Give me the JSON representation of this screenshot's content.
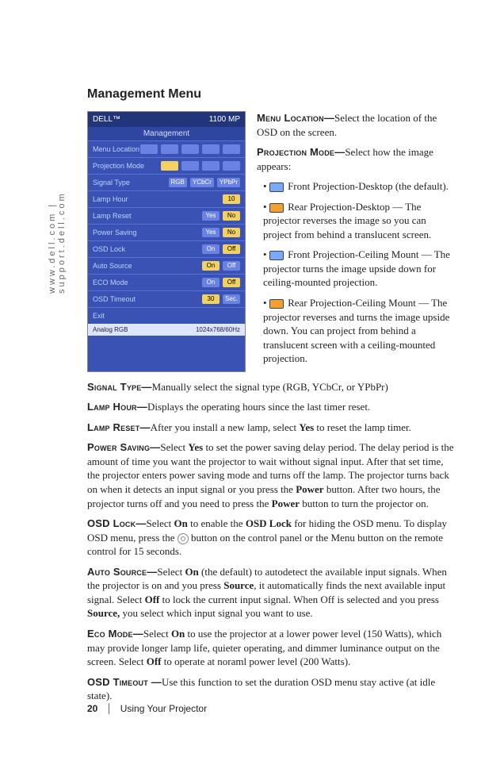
{
  "sidebar": "www.dell.com | support.dell.com",
  "heading": "Management Menu",
  "osd": {
    "brand": "DELL™",
    "model": "1100 MP",
    "title": "Management",
    "rows": [
      {
        "label": "Menu Location",
        "chips": [
          "",
          "",
          "",
          "",
          ""
        ],
        "hi": -1
      },
      {
        "label": "Projection Mode",
        "chips": [
          "",
          "",
          "",
          ""
        ],
        "hi": 0
      },
      {
        "label": "Signal Type",
        "chips": [
          "RGB",
          "YCbCr",
          "YPbPr"
        ],
        "hi": -1
      },
      {
        "label": "Lamp Hour",
        "chips": [
          "10"
        ],
        "hi": 0
      },
      {
        "label": "Lamp Reset",
        "chips": [
          "Yes",
          "No"
        ],
        "hi": 1
      },
      {
        "label": "Power Saving",
        "chips": [
          "Yes",
          "No"
        ],
        "hi": 1
      },
      {
        "label": "OSD Lock",
        "chips": [
          "On",
          "Off"
        ],
        "hi": 1
      },
      {
        "label": "Auto Source",
        "chips": [
          "On",
          "Off"
        ],
        "hi": 0
      },
      {
        "label": "ECO Mode",
        "chips": [
          "On",
          "Off"
        ],
        "hi": 1
      },
      {
        "label": "OSD Timeout",
        "chips": [
          "30",
          "Sec."
        ],
        "hi": 0
      },
      {
        "label": "Exit",
        "chips": [],
        "hi": -1
      }
    ],
    "footer_left": "Analog RGB",
    "footer_right": "1024x768/60Hz"
  },
  "rightcol": {
    "p1a": "Menu Location—",
    "p1b": "Select the location of the OSD on the screen.",
    "p2a": "Projection Mode—",
    "p2b": "Select how the image appears:",
    "b1": " Front Projection-Desktop (the default).",
    "b2": " Rear Projection-Desktop — The projector reverses the image so you can project from behind a translucent screen.",
    "b3": " Front Projection-Ceiling Mount — The projector turns the image upside down for ceiling-mounted projection.",
    "b4": " Rear Projection-Ceiling Mount — The projector reverses and turns the image upside down. You can project from behind a translucent screen with a ceiling-mounted projection."
  },
  "paras": {
    "st_a": "Signal Type—",
    "st_b": "Manually select the signal type (RGB, YCbCr, or YPbPr)",
    "lh_a": "Lamp Hour—",
    "lh_b": "Displays the operating hours since the last timer reset.",
    "lr_a": "Lamp Reset—",
    "lr_b1": "After you install a new lamp, select ",
    "lr_yes": "Yes",
    "lr_b2": " to reset the lamp timer.",
    "ps_a": "Power Saving—",
    "ps_b1": "Select ",
    "ps_yes": "Yes",
    "ps_b2": " to set the power saving delay period. The delay period is the amount of time you want the projector to wait without signal input. After that set time, the projector enters power saving mode and turns off the lamp. The projector turns back on when it detects an input signal or you press the ",
    "ps_pw1": "Power",
    "ps_b3": " button. After two hours, the projector turns off and you need to press the ",
    "ps_pw2": "Power",
    "ps_b4": " button to turn the projector on.",
    "ol_a": "OSD Lock—",
    "ol_b1": "Select ",
    "ol_on": "On",
    "ol_b2": " to enable the ",
    "ol_bold": "OSD Lock",
    "ol_b3": " for hiding the OSD menu. To display OSD menu, press the ",
    "ol_b4": " button on the control panel or the Menu button on the remote control for 15 seconds.",
    "as_a": "Auto Source—",
    "as_b1": "Select ",
    "as_on": "On",
    "as_b2": " (the default) to autodetect the available input signals. When the projector is on and you press ",
    "as_src": "Source",
    "as_b3": ", it automatically finds the next available input signal. Select ",
    "as_off": "Off",
    "as_b4": " to lock the current input signal. When Off is selected and you press ",
    "as_src2": "Source,",
    "as_b5": " you select which input signal you want to use.",
    "em_a": "Eco Mode—",
    "em_b1": "Select ",
    "em_on": "On",
    "em_b2": " to use the projector at a lower power level (150 Watts), which may provide longer lamp life, quieter operating, and dimmer luminance output on the screen. Select ",
    "em_off": "Off",
    "em_b3": " to operate at noraml power level (200 Watts).",
    "ot_a": "OSD Timeout —",
    "ot_b": "Use this function to set the duration OSD menu stay active (at idle state)."
  },
  "footer": {
    "page": "20",
    "text": "Using Your Projector"
  }
}
